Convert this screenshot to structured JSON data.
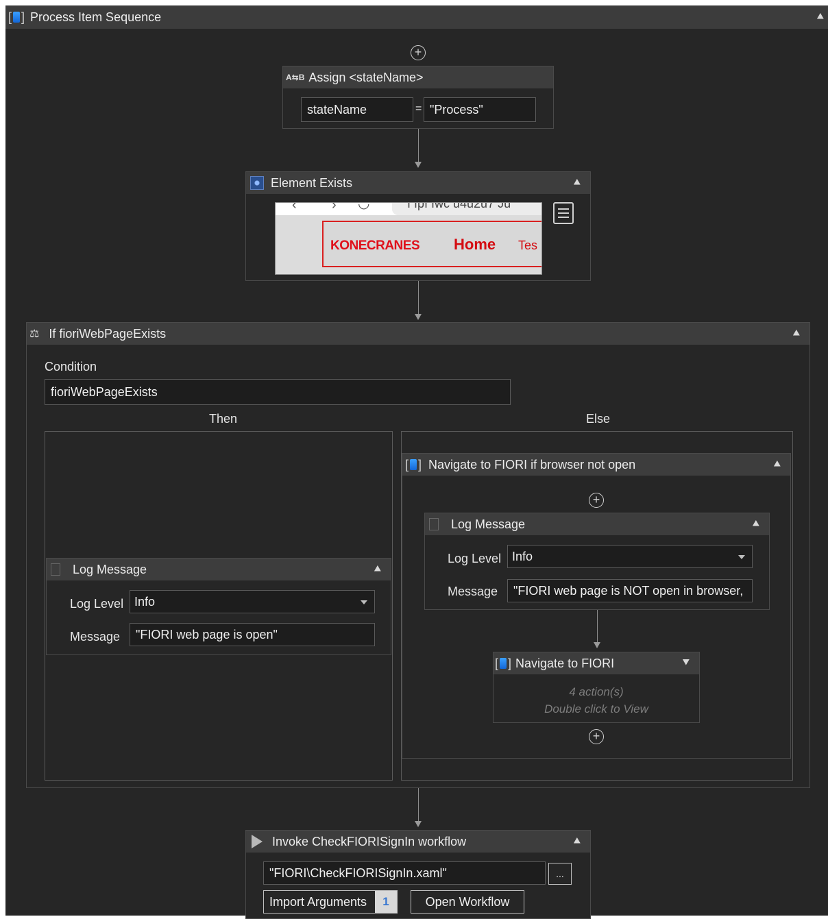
{
  "sequence": {
    "title": "Process Item Sequence"
  },
  "assign": {
    "title": "Assign <stateName>",
    "icon": "assign-icon",
    "left_value": "stateName",
    "equals": "=",
    "right_value": "\"Process\""
  },
  "element_exists": {
    "title": "Element Exists",
    "icon": "element-exists-icon",
    "preview": {
      "logo_text": "KONECRANES",
      "home_text": "Home",
      "tab_text": "Tes",
      "url_fragment": "ı ıpı ıwc u4u2u7 Ju"
    }
  },
  "if_activity": {
    "title": "If fioriWebPageExists",
    "icon": "if-icon",
    "condition_label": "Condition",
    "condition_value": "fioriWebPageExists",
    "then_label": "Then",
    "else_label": "Else"
  },
  "then_log": {
    "title": "Log Message",
    "log_level_label": "Log Level",
    "log_level_value": "Info",
    "message_label": "Message",
    "message_value": "\"FIORI web page is open\""
  },
  "navigate_seq": {
    "title": "Navigate to FIORI if browser not open"
  },
  "else_log": {
    "title": "Log Message",
    "log_level_label": "Log Level",
    "log_level_value": "Info",
    "message_label": "Message",
    "message_value": "\"FIORI web page is NOT open in  browser,"
  },
  "navigate_fiori": {
    "title": "Navigate to FIORI",
    "actions": "4 action(s)",
    "hint": "Double click to View"
  },
  "invoke": {
    "title": "Invoke CheckFIORISignIn workflow",
    "path_value": "\"FIORI\\CheckFIORISignIn.xaml\"",
    "browse": "...",
    "import_label": "Import Arguments",
    "import_count": "1",
    "open_label": "Open Workflow"
  },
  "icons": {
    "collapse": "chevron-double-up-icon",
    "expand": "chevron-double-down-icon",
    "add": "plus-circle-icon"
  }
}
